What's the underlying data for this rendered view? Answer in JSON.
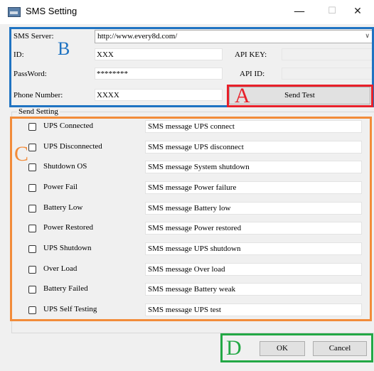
{
  "window": {
    "title": "SMS Setting",
    "minimize_glyph": "—",
    "maximize_glyph": "☐",
    "close_glyph": "✕"
  },
  "server": {
    "label": "SMS Server:",
    "value": "http://www.every8d.com/"
  },
  "id": {
    "label": "ID:",
    "value": "XXX"
  },
  "password": {
    "label": "PassWord:",
    "value": "********"
  },
  "phone": {
    "label": "Phone Number:",
    "value": "XXXX"
  },
  "api_key": {
    "label": "API KEY:",
    "value": ""
  },
  "api_id": {
    "label": "API ID:",
    "value": ""
  },
  "send_test_label": "Send Test",
  "send_setting": {
    "title": "Send Setting",
    "items": [
      {
        "label": "UPS Connected",
        "message": "SMS message UPS connect",
        "checked": false
      },
      {
        "label": "UPS Disconnected",
        "message": "SMS message UPS disconnect",
        "checked": false
      },
      {
        "label": "Shutdown OS",
        "message": "SMS message System shutdown",
        "checked": false
      },
      {
        "label": "Power Fail",
        "message": "SMS message Power failure",
        "checked": false
      },
      {
        "label": "Battery Low",
        "message": "SMS message Battery low",
        "checked": false
      },
      {
        "label": "Power Restored",
        "message": "SMS message Power restored",
        "checked": false
      },
      {
        "label": "UPS Shutdown",
        "message": "SMS message UPS shutdown",
        "checked": false
      },
      {
        "label": "Over Load",
        "message": "SMS message Over load",
        "checked": false
      },
      {
        "label": "Battery Failed",
        "message": "SMS message Battery weak",
        "checked": false
      },
      {
        "label": "UPS Self Testing",
        "message": "SMS message UPS test",
        "checked": false
      }
    ]
  },
  "ok_label": "OK",
  "cancel_label": "Cancel",
  "annotations": {
    "A": {
      "letter": "A",
      "color": "#e8202a"
    },
    "B": {
      "letter": "B",
      "color": "#1f73c2"
    },
    "C": {
      "letter": "C",
      "color": "#f28c3a"
    },
    "D": {
      "letter": "D",
      "color": "#23a845"
    }
  },
  "colors": {
    "dialog_bg": "#f0f0f0",
    "button_bg": "#e1e1e1"
  }
}
